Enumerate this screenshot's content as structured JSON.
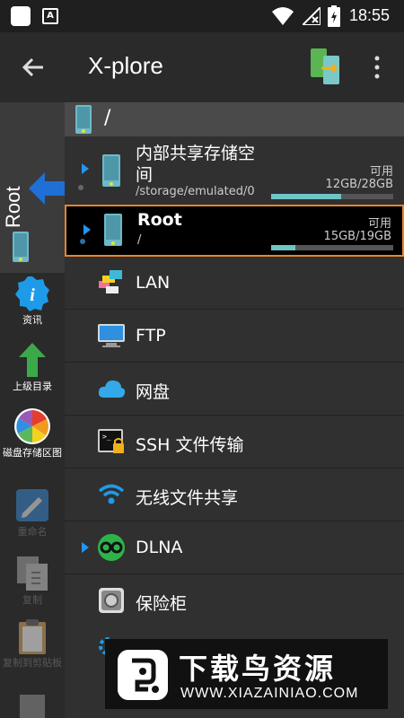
{
  "status": {
    "time": "18:55",
    "notify_letter": "A"
  },
  "appbar": {
    "title": "X-plore"
  },
  "sidebar": {
    "tab_label": "Root",
    "buttons": [
      {
        "label": "资讯",
        "icon": "info-icon"
      },
      {
        "label": "上级目录",
        "icon": "up-arrow-icon"
      },
      {
        "label": "磁盘存储区图",
        "icon": "disk-map-icon"
      },
      {
        "label": "重命名",
        "icon": "rename-icon"
      },
      {
        "label": "复制",
        "icon": "copy-icon"
      },
      {
        "label": "复制到剪贴板",
        "icon": "clipboard-icon"
      }
    ]
  },
  "path": {
    "current": "/"
  },
  "drives": [
    {
      "name": "内部共享存储空",
      "name_line2": "间",
      "path": "/storage/emulated/0",
      "available_label": "可用",
      "size": "12GB/28GB",
      "used_fraction": 0.57
    },
    {
      "name": "Root",
      "path": "/",
      "available_label": "可用",
      "size": "15GB/19GB",
      "used_fraction": 0.2
    }
  ],
  "items": [
    {
      "label": "LAN",
      "icon": "lan-icon"
    },
    {
      "label": "FTP",
      "icon": "ftp-icon"
    },
    {
      "label": "网盘",
      "icon": "cloud-icon"
    },
    {
      "label": "SSH 文件传输",
      "icon": "ssh-icon"
    },
    {
      "label": "无线文件共享",
      "icon": "wifi-share-icon"
    },
    {
      "label": "DLNA",
      "icon": "dlna-icon"
    },
    {
      "label": "保险柜",
      "icon": "vault-icon"
    }
  ],
  "watermark": {
    "title": "下载鸟资源",
    "url": "WWW.XIAZAINIAO.COM"
  },
  "colors": {
    "accent": "#2196f3",
    "selection_border": "#e8862a",
    "bar_fill": "#6fc4c4"
  }
}
